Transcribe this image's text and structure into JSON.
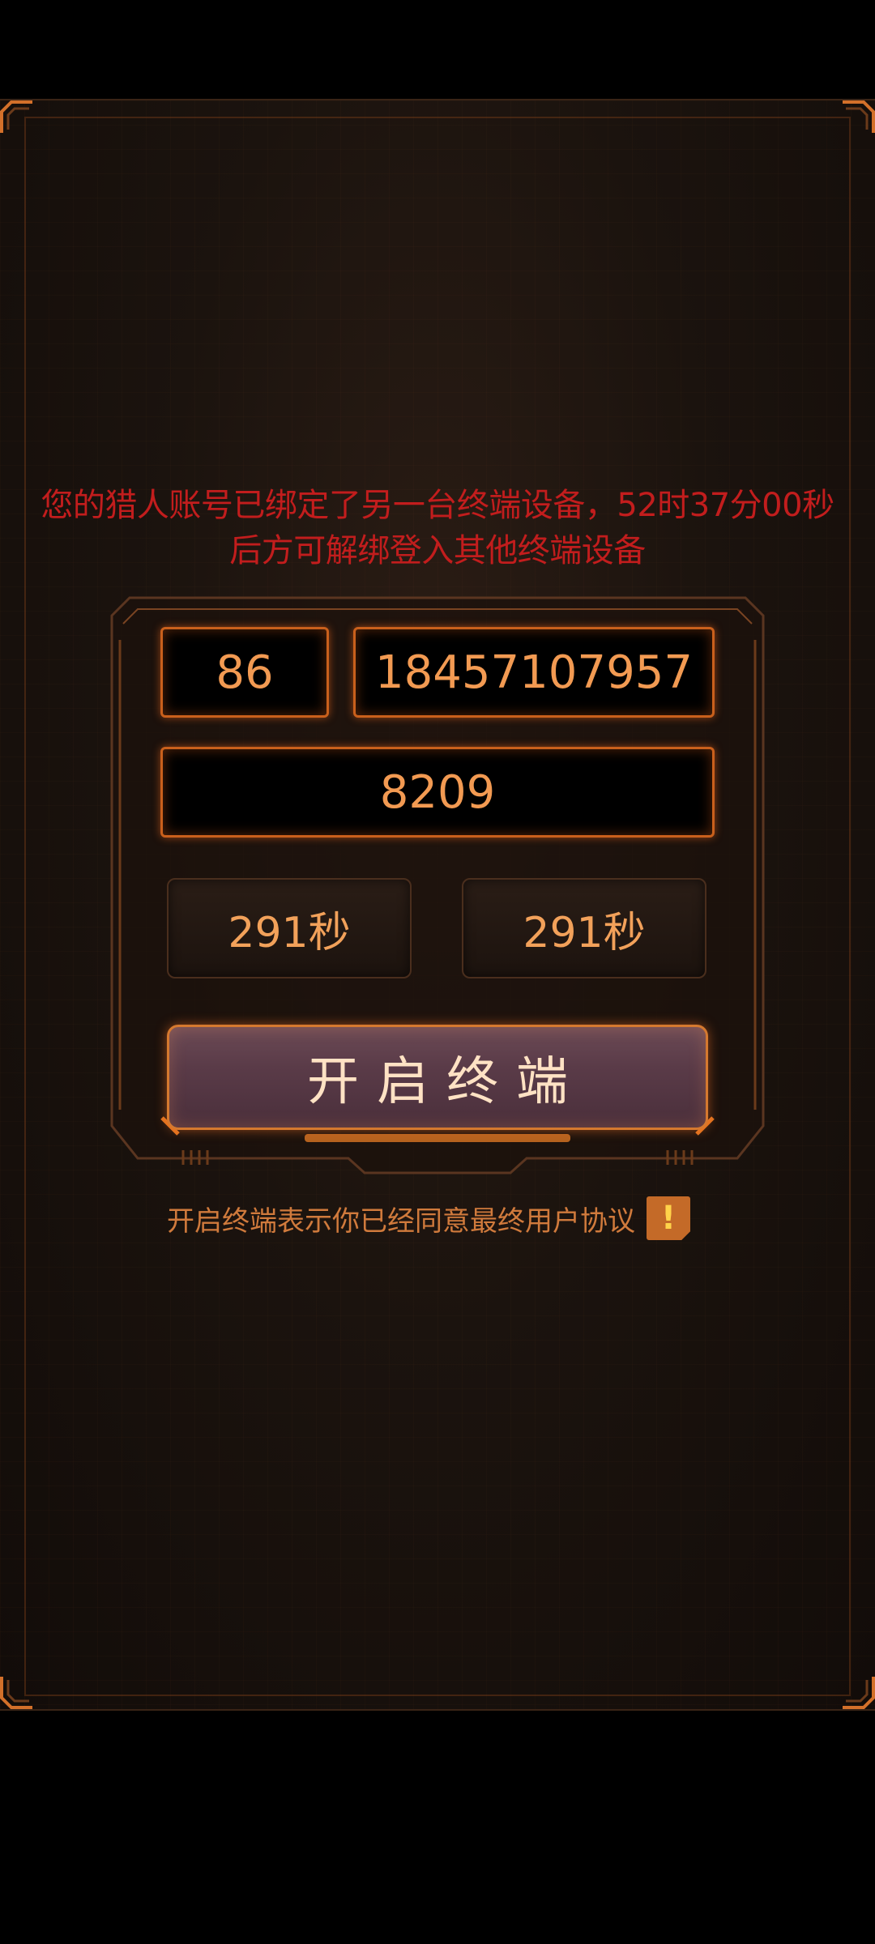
{
  "warning": {
    "line1": "您的猎人账号已绑定了另一台终端设备，52时37分00秒",
    "line2": "后方可解绑登入其他终端设备"
  },
  "login": {
    "country_code": "86",
    "phone_number": "18457107957",
    "verification_code": "8209",
    "timer_left": "291秒",
    "timer_right": "291秒",
    "start_button": "开启终端"
  },
  "agreement": {
    "text": "开启终端表示你已经同意最终用户协议",
    "icon_glyph": "!",
    "icon": "alert-icon"
  },
  "colors": {
    "accent": "#e0731f",
    "warning": "#c21d1d",
    "field_text": "#f29a52"
  }
}
